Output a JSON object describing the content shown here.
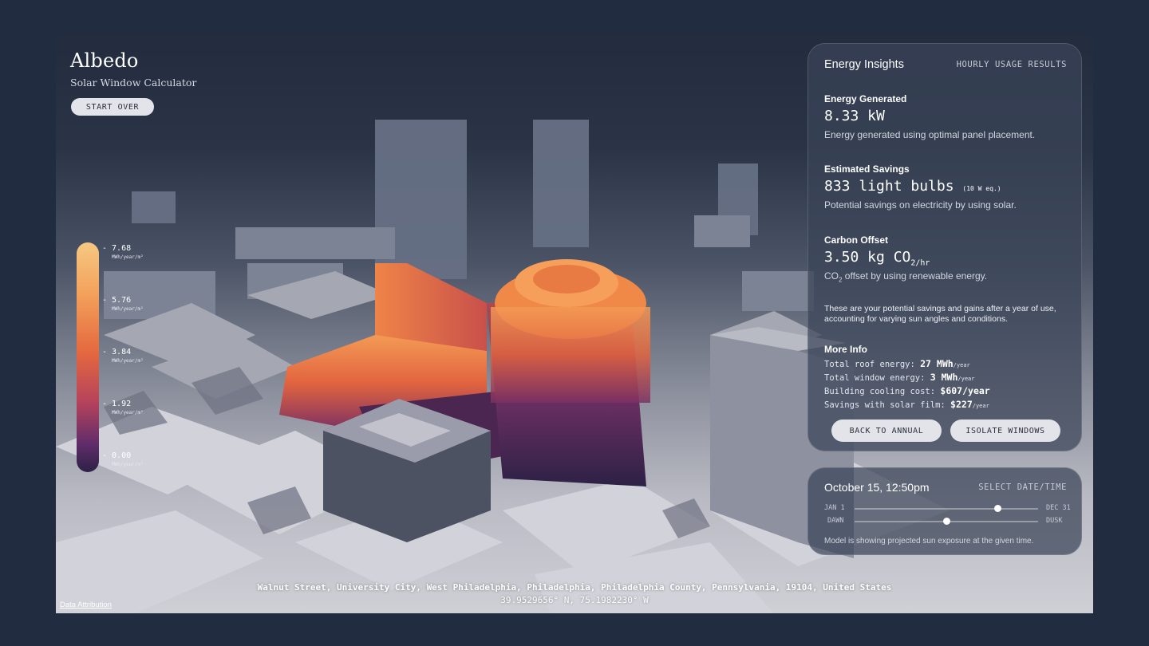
{
  "brand": {
    "title": "Albedo",
    "subtitle": "Solar Window Calculator"
  },
  "header": {
    "start_over": "START OVER"
  },
  "legend": {
    "ticks": [
      {
        "value": "- 7.68",
        "unit": "MWh/year/m²"
      },
      {
        "value": "- 5.76",
        "unit": "MWh/year/m²"
      },
      {
        "value": "- 3.84",
        "unit": "MWh/year/m²"
      },
      {
        "value": "- 1.92",
        "unit": "MWh/year/m²"
      },
      {
        "value": "- 0.00",
        "unit": "MWh/year/m²"
      }
    ],
    "colors": [
      "#f6c882",
      "#f3a25c",
      "#e4683e",
      "#b4425c",
      "#5f2c6a",
      "#2d2145"
    ]
  },
  "insights": {
    "title": "Energy Insights",
    "link": "HOURLY USAGE RESULTS",
    "energy": {
      "label": "Energy Generated",
      "value": "8.33 kW",
      "desc": "Energy generated using optimal panel placement."
    },
    "savings": {
      "label": "Estimated Savings",
      "value": "833 light bulbs",
      "value_small": "(10 W eq.)",
      "desc": "Potential savings on electricity by using solar."
    },
    "carbon": {
      "label": "Carbon Offset",
      "value": "3.50 kg CO",
      "value_sub": "2/hr",
      "desc_pre": "CO",
      "desc_sub": "2",
      "desc_post": " offset by using renewable energy."
    },
    "note": "These are your potential savings and gains after a year of use, accounting for varying sun angles and conditions.",
    "more_info": {
      "title": "More Info",
      "rows": [
        {
          "label": "Total roof energy:",
          "value": "27 MWh",
          "unit": "/year"
        },
        {
          "label": "Total window energy:",
          "value": "3 MWh",
          "unit": "/year"
        },
        {
          "label": "Building cooling cost:",
          "value": "$607/year",
          "unit": ""
        },
        {
          "label": "Savings with solar film:",
          "value": "$227",
          "unit": "/year"
        }
      ]
    },
    "buttons": {
      "back": "BACK TO ANNUAL",
      "isolate": "ISOLATE WINDOWS"
    }
  },
  "date_panel": {
    "date": "October 15, 12:50pm",
    "link": "SELECT DATE/TIME",
    "date_slider": {
      "start": "JAN 1",
      "end": "DEC 31",
      "position": 0.78
    },
    "time_slider": {
      "start": "DAWN",
      "end": "DUSK",
      "position": 0.5
    },
    "note": "Model is showing projected sun exposure at the given time."
  },
  "footer": {
    "address": "Walnut Street, University City, West Philadelphia, Philadelphia, Philadelphia County, Pennsylvania, 19104, United States",
    "coords": "39.9529656° N, 75.1982230° W",
    "attribution": "Data Attribution"
  }
}
